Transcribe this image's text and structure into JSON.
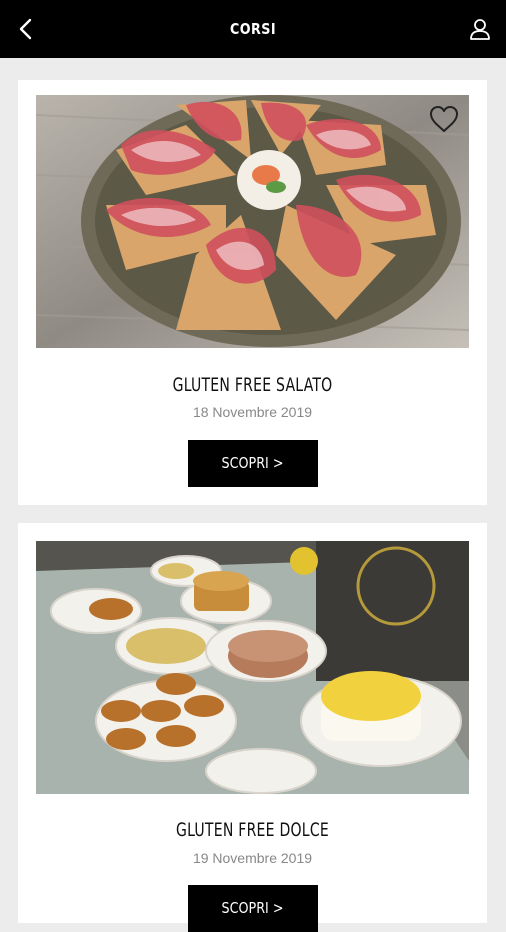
{
  "header": {
    "title": "CORSI",
    "back_icon": "chevron-left-icon",
    "user_icon": "user-icon"
  },
  "courses": [
    {
      "title": "GLUTEN FREE SALATO",
      "date": "18 Novembre 2019",
      "button_label": "SCOPRI >"
    },
    {
      "title": "GLUTEN FREE DOLCE",
      "date": "19 Novembre 2019",
      "button_label": "SCOPRI >"
    }
  ],
  "colors": {
    "topbar": "#000000",
    "background": "#ececec",
    "card": "#ffffff",
    "button": "#000000"
  }
}
